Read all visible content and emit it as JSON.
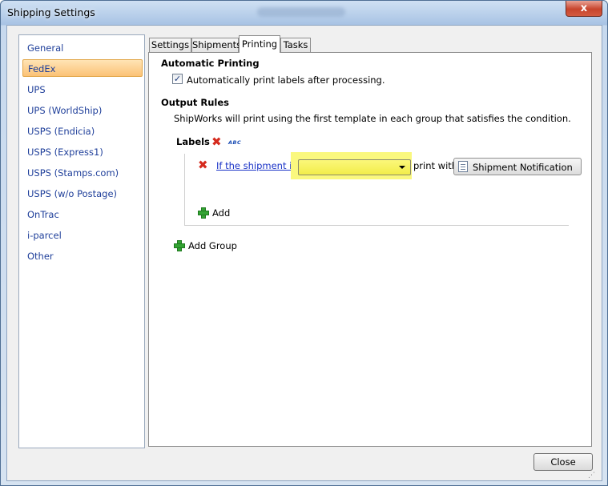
{
  "window": {
    "title": "Shipping Settings",
    "close_glyph": "x"
  },
  "sidebar": {
    "items": [
      {
        "label": "General",
        "selected": false
      },
      {
        "label": "FedEx",
        "selected": true
      },
      {
        "label": "UPS",
        "selected": false
      },
      {
        "label": "UPS (WorldShip)",
        "selected": false
      },
      {
        "label": "USPS (Endicia)",
        "selected": false
      },
      {
        "label": "USPS (Express1)",
        "selected": false
      },
      {
        "label": "USPS (Stamps.com)",
        "selected": false
      },
      {
        "label": "USPS (w/o Postage)",
        "selected": false
      },
      {
        "label": "OnTrac",
        "selected": false
      },
      {
        "label": "i-parcel",
        "selected": false
      },
      {
        "label": "Other",
        "selected": false
      }
    ]
  },
  "tabs": [
    {
      "label": "Settings",
      "active": false
    },
    {
      "label": "Shipments",
      "active": false
    },
    {
      "label": "Printing",
      "active": true
    },
    {
      "label": "Tasks",
      "active": false
    }
  ],
  "printing": {
    "automatic_heading": "Automatic Printing",
    "auto_print_label": "Automatically print labels after processing.",
    "auto_print_checked": true,
    "check_glyph": "✓",
    "output_heading": "Output Rules",
    "output_description": "ShipWorks will print using the first template in each group that satisfies the condition.",
    "group": {
      "name": "Labels",
      "rename_badge": "ABC",
      "rule": {
        "condition_link": "If the shipment is in",
        "condition_value": "",
        "print_with_label": "print with",
        "template_name": "Shipment Notification"
      },
      "add_label": "Add"
    },
    "add_group_label": "Add Group"
  },
  "footer": {
    "close_label": "Close",
    "resize_grip": "⋰"
  },
  "colors": {
    "selection_orange": "#fbc276",
    "link_blue": "#1932c7",
    "highlight_yellow": "#faf87e",
    "delete_red": "#d52b1e",
    "add_green": "#33a333"
  }
}
